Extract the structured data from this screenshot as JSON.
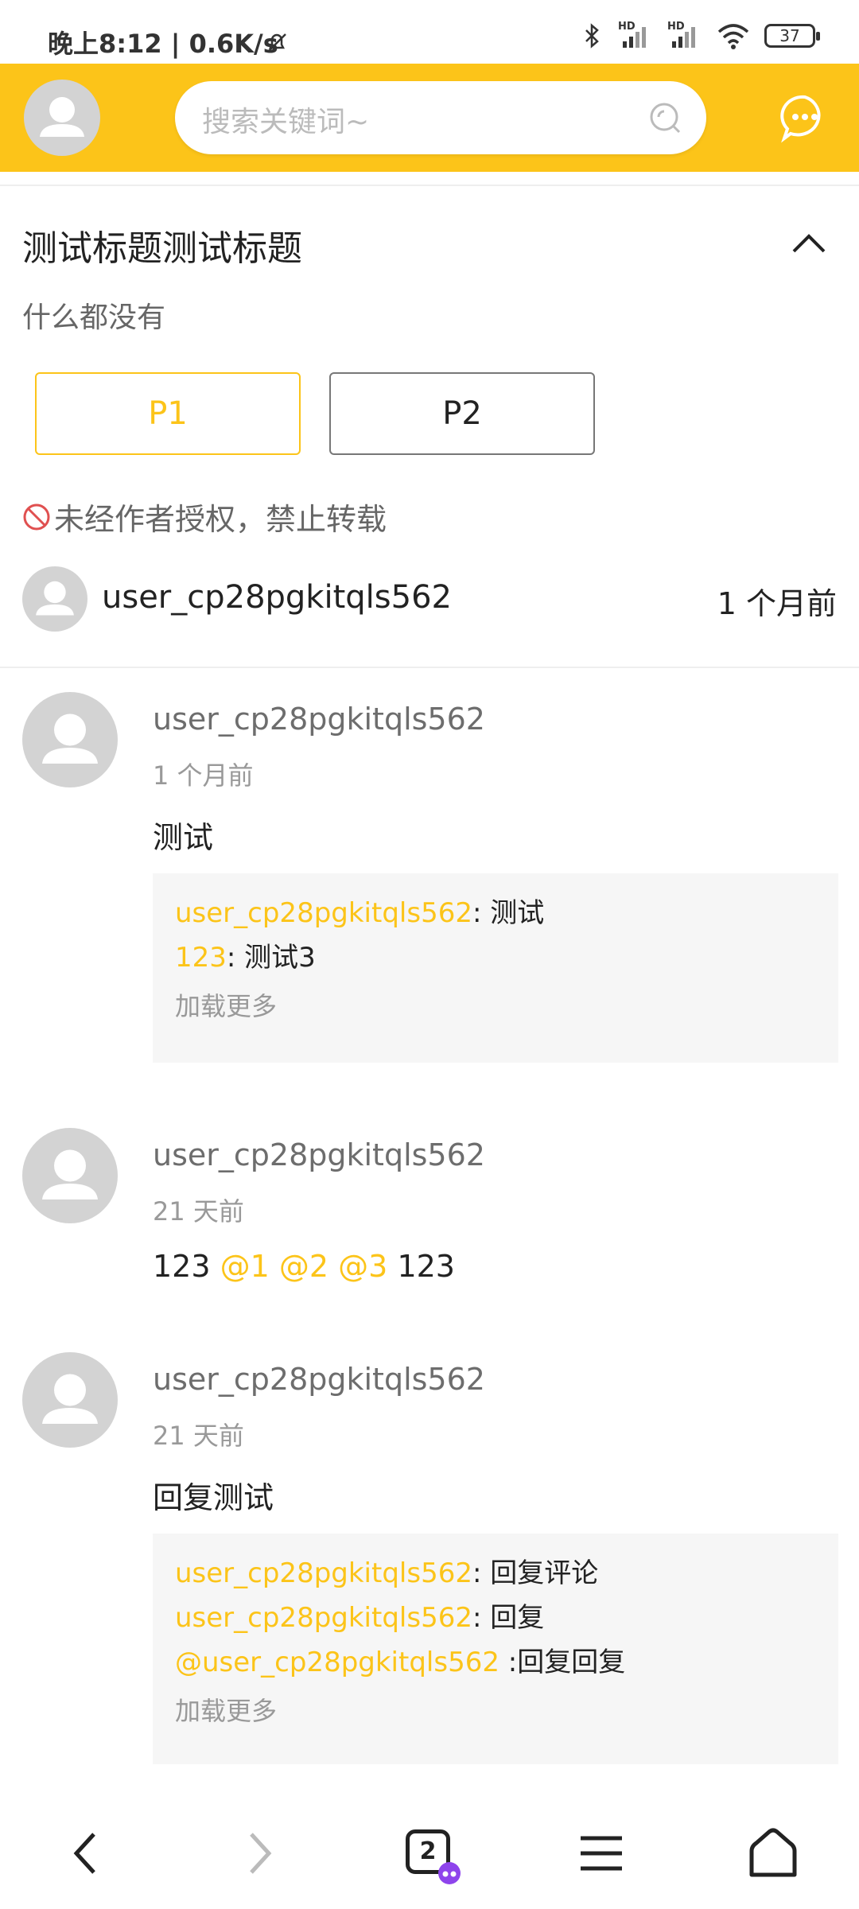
{
  "status_bar": {
    "time_speed": "晚上8:12 | 0.6K/s",
    "battery": "37",
    "signal_label_1": "HD",
    "signal_label_2": "HD"
  },
  "header": {
    "search_placeholder": "搜索关键词~"
  },
  "post": {
    "title": "测试标题测试标题",
    "description": "什么都没有",
    "pages": [
      "P1",
      "P2"
    ],
    "copyright_notice": "未经作者授权，禁止转载",
    "author": "user_cp28pgkitqls562",
    "time": "1 个月前"
  },
  "comments": [
    {
      "user": "user_cp28pgkitqls562",
      "time": "1 个月前",
      "text": "测试",
      "replies": [
        {
          "user": "user_cp28pgkitqls562",
          "text": ": 测试"
        },
        {
          "user": "123",
          "text": ": 测试3"
        }
      ],
      "load_more": "加载更多"
    },
    {
      "user": "user_cp28pgkitqls562",
      "time": "21 天前",
      "text_parts": [
        "123 ",
        "@1",
        " ",
        "@2",
        " ",
        "@3",
        " 123"
      ]
    },
    {
      "user": "user_cp28pgkitqls562",
      "time": "21 天前",
      "text": "回复测试",
      "replies": [
        {
          "user": "user_cp28pgkitqls562",
          "text": ": 回复评论"
        },
        {
          "user": "user_cp28pgkitqls562",
          "text": ": 回复"
        },
        {
          "mention": "@user_cp28pgkitqls562",
          "text": " :回复回复"
        }
      ],
      "load_more": "加载更多"
    }
  ],
  "bottom_nav": {
    "tab_count": "2"
  },
  "colors": {
    "accent": "#fcc419",
    "avatar": "#d3d3d3"
  }
}
